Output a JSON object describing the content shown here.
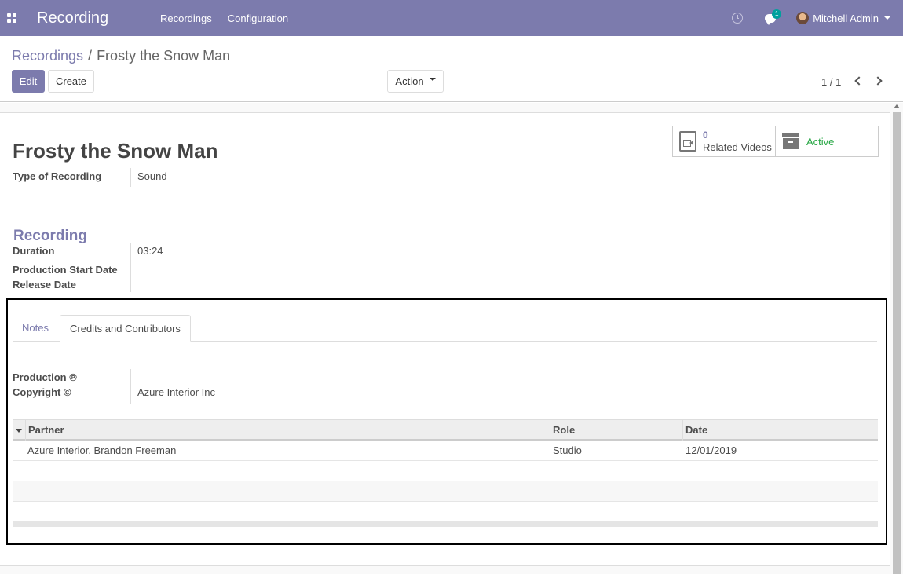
{
  "app": {
    "title": "Recording",
    "menu": [
      "Recordings",
      "Configuration"
    ],
    "chat_count": "1",
    "user_name": "Mitchell Admin",
    "accent_color": "#7c7bad"
  },
  "breadcrumb": {
    "parent": "Recordings",
    "separator": "/",
    "current": "Frosty the Snow Man"
  },
  "toolbar": {
    "edit_label": "Edit",
    "create_label": "Create",
    "action_label": "Action"
  },
  "pager": {
    "text": "1 / 1"
  },
  "record": {
    "title": "Frosty the Snow Man",
    "type_label": "Type of Recording",
    "type_value": "Sound",
    "section_title": "Recording",
    "duration_label": "Duration",
    "duration_value": "03:24",
    "prod_start_label": "Production Start Date",
    "release_label": "Release Date"
  },
  "smart_buttons": {
    "videos_count": "0",
    "videos_label": "Related Videos",
    "active_label": "Active",
    "active_color": "#28a745"
  },
  "notebook": {
    "tabs": [
      "Notes",
      "Credits and Contributors"
    ],
    "active_tab": "Credits and Contributors",
    "production_label": "Production ℗",
    "copyright_label": "Copyright ©",
    "copyright_value": "Azure Interior Inc"
  },
  "credits_table": {
    "columns": [
      "Partner",
      "Role",
      "Date"
    ],
    "rows": [
      {
        "partner": "Azure Interior, Brandon Freeman",
        "role": "Studio",
        "date": "12/01/2019"
      }
    ]
  }
}
